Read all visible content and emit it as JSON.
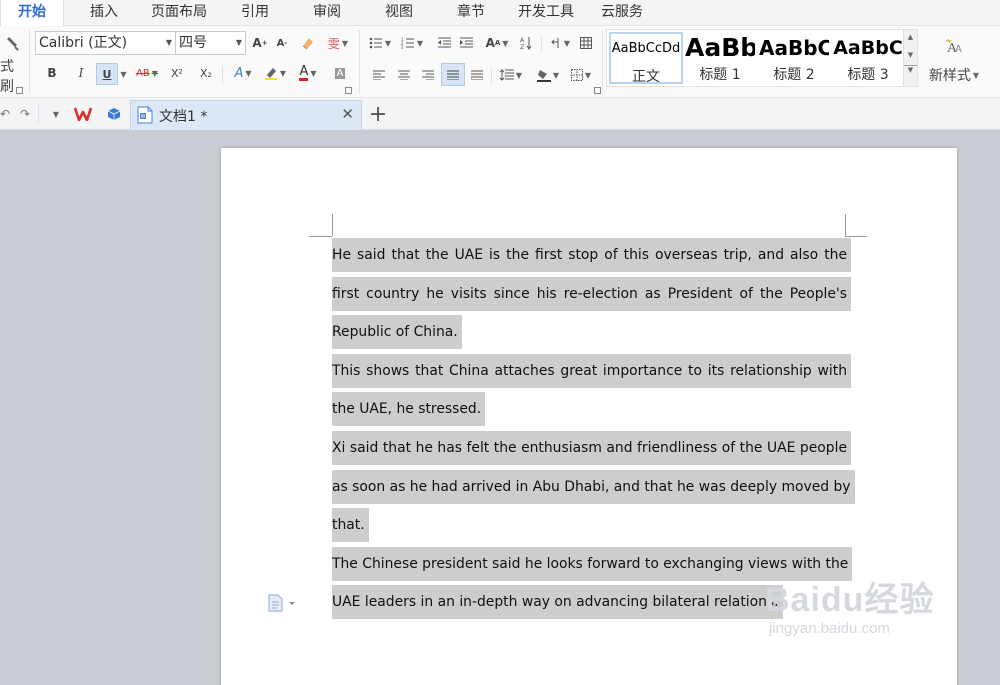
{
  "menu": {
    "tabs": [
      "开始",
      "插入",
      "页面布局",
      "引用",
      "审阅",
      "视图",
      "章节",
      "开发工具",
      "云服务"
    ],
    "active": "开始"
  },
  "ribbon": {
    "format_painter_label": "式刷",
    "font_name": "Calibri (正文)",
    "font_size": "四号",
    "bold": "B",
    "italic": "I",
    "underline": "U",
    "strike": "AB",
    "superscript": "X²",
    "subscript": "X₂",
    "styles": {
      "items": [
        {
          "preview": "AaBbCcDd",
          "label": "正文"
        },
        {
          "preview": "AaBb",
          "label": "标题 1"
        },
        {
          "preview": "AaBbC",
          "label": "标题 2"
        },
        {
          "preview": "AaBbC",
          "label": "标题 3"
        }
      ],
      "new_style_label": "新样式"
    }
  },
  "tabbar": {
    "doc_title": "文档1 *",
    "new_tab_symbol": "+"
  },
  "document": {
    "paragraphs": [
      "He said that the UAE is the first stop of this overseas trip, and also the first country he visits since his re-election as President of the People's Republic of China.",
      "This shows that China attaches great importance to its relationship with the UAE, he stressed.",
      "Xi said that he has felt the enthusiasm and friendliness of the UAE people as soon as he had arrived in Abu Dhabi, and that he was deeply moved by that.",
      "The Chinese president said he looks forward to exchanging views with the UAE leaders in an in-depth way on advancing bilateral relations."
    ]
  },
  "watermark": {
    "brand": "Baidu经验",
    "url": "jingyan.baidu.com"
  },
  "colors": {
    "accent": "#2b6cd5",
    "selection": "#cdcdcd",
    "workspace": "#c9ccd3"
  }
}
